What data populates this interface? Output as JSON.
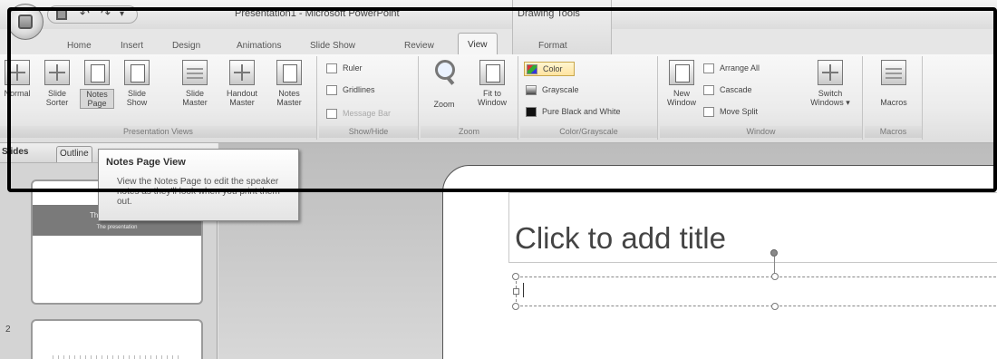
{
  "title_bar": {
    "title": "Presentation1 - Microsoft PowerPoint",
    "contextual_tab_group": "Drawing Tools",
    "qat": {
      "undo_glyph": "↶",
      "redo_glyph": "↷",
      "more_glyph": "▾"
    }
  },
  "tabs": [
    {
      "label": "Home",
      "active": false
    },
    {
      "label": "Insert",
      "active": false
    },
    {
      "label": "Design",
      "active": false
    },
    {
      "label": "Animations",
      "active": false
    },
    {
      "label": "Slide Show",
      "active": false
    },
    {
      "label": "Review",
      "active": false
    },
    {
      "label": "View",
      "active": true
    },
    {
      "label": "Format",
      "active": false
    }
  ],
  "ribbon": {
    "presentation_views": {
      "label": "Presentation Views",
      "buttons": [
        {
          "label": "Normal",
          "icon": "normal-view-icon"
        },
        {
          "label": "Slide Sorter",
          "icon": "slide-sorter-icon"
        },
        {
          "label": "Notes Page",
          "icon": "notes-page-icon"
        },
        {
          "label": "Slide Show",
          "icon": "slide-show-icon"
        },
        {
          "label": "Slide Master",
          "icon": "slide-master-icon"
        },
        {
          "label": "Handout Master",
          "icon": "handout-master-icon"
        },
        {
          "label": "Notes Master",
          "icon": "notes-master-icon"
        }
      ]
    },
    "show_hide": {
      "label": "Show/Hide",
      "items": [
        {
          "label": "Ruler",
          "checked": false,
          "enabled": true
        },
        {
          "label": "Gridlines",
          "checked": false,
          "enabled": true
        },
        {
          "label": "Message Bar",
          "checked": false,
          "enabled": false
        }
      ]
    },
    "zoom": {
      "label": "Zoom",
      "buttons": [
        {
          "label": "Zoom",
          "icon": "magnifier-icon"
        },
        {
          "label": "Fit to Window",
          "icon": "fit-to-window-icon"
        }
      ]
    },
    "color_grayscale": {
      "label": "Color/Grayscale",
      "items": [
        {
          "label": "Color",
          "selected": true
        },
        {
          "label": "Grayscale",
          "selected": false
        },
        {
          "label": "Pure Black and White",
          "selected": false
        }
      ]
    },
    "window": {
      "label": "Window",
      "new_window": "New Window",
      "arrange_all": "Arrange All",
      "cascade": "Cascade",
      "move_split": "Move Split",
      "switch_windows": "Switch Windows ▾"
    },
    "macros": {
      "label": "Macros",
      "button": "Macros"
    }
  },
  "left_pane": {
    "tabs": [
      "Slides",
      "Outline"
    ],
    "thumb1_title": "The presentation",
    "thumb1_subtitle": "The presentation",
    "slide2_number": "2"
  },
  "tooltip": {
    "title": "Notes Page View",
    "description": "View the Notes Page to edit the speaker notes as they'll look when you print them out."
  },
  "slide": {
    "title_placeholder": "Click to add title"
  }
}
